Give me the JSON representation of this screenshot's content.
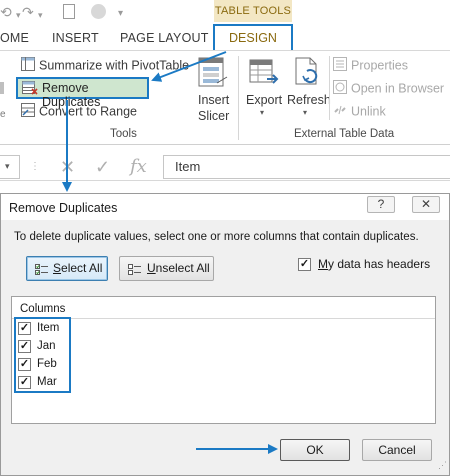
{
  "ribbon": {
    "context_tab_label": "TABLE TOOLS",
    "tabs": [
      "OME",
      "INSERT",
      "PAGE LAYOUT",
      "DESIGN"
    ],
    "tools_group": {
      "items": [
        "Summarize with PivotTable",
        "Remove Duplicates",
        "Convert to Range"
      ],
      "label": "Tools"
    },
    "insert_slicer": {
      "line1": "Insert",
      "line2": "Slicer"
    },
    "external_group": {
      "export_label": "Export",
      "refresh_label": "Refresh",
      "items": [
        "Properties",
        "Open in Browser",
        "Unlink"
      ],
      "label": "External Table Data"
    }
  },
  "formula_bar": {
    "fx_label": "fx",
    "value": "Item"
  },
  "dialog": {
    "title": "Remove Duplicates",
    "help_glyph": "?",
    "close_glyph": "✕",
    "instructions": "To delete duplicate values, select one or more columns that contain duplicates.",
    "select_all": {
      "underlined": "S",
      "rest": "elect All"
    },
    "unselect_all": {
      "underlined": "U",
      "rest": "nselect All"
    },
    "headers_check": {
      "checked": true,
      "underlined": "M",
      "rest": "y data has headers"
    },
    "columns_header": "Columns",
    "columns": [
      {
        "label": "Item",
        "checked": true
      },
      {
        "label": "Jan",
        "checked": true
      },
      {
        "label": "Feb",
        "checked": true
      },
      {
        "label": "Mar",
        "checked": true
      }
    ],
    "ok_label": "OK",
    "cancel_label": "Cancel"
  },
  "colors": {
    "highlight_blue": "#1b7ac4",
    "context_tab_bg": "#f3e7c4",
    "selected_button_bg": "#cfe6cf"
  }
}
